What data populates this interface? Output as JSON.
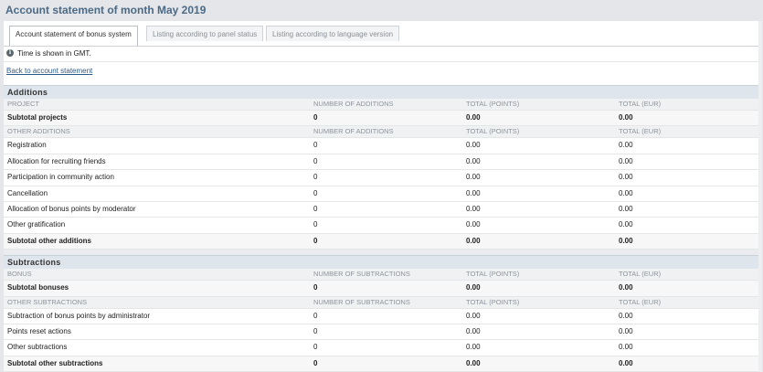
{
  "page_title": "Account statement of month May 2019",
  "tabs": [
    {
      "label": "Account statement of bonus system",
      "active": true
    },
    {
      "label": "Listing according to panel status",
      "active": false
    },
    {
      "label": "Listing according to language version",
      "active": false
    }
  ],
  "info": {
    "icon": "info-icon",
    "text": "Time is shown in GMT."
  },
  "back_link": "Back to account statement",
  "additions": {
    "title": "Additions",
    "project_header": [
      "PROJECT",
      "NUMBER OF ADDITIONS",
      "TOTAL (POINTS)",
      "TOTAL (EUR)"
    ],
    "subtotal_projects": [
      "Subtotal projects",
      "0",
      "0.00",
      "0.00"
    ],
    "other_header": [
      "OTHER ADDITIONS",
      "NUMBER OF ADDITIONS",
      "TOTAL (POINTS)",
      "TOTAL (EUR)"
    ],
    "rows": [
      [
        "Registration",
        "0",
        "0.00",
        "0.00"
      ],
      [
        "Allocation for recruiting friends",
        "0",
        "0.00",
        "0.00"
      ],
      [
        "Participation in community action",
        "0",
        "0.00",
        "0.00"
      ],
      [
        "Cancellation",
        "0",
        "0.00",
        "0.00"
      ],
      [
        "Allocation of bonus points by moderator",
        "0",
        "0.00",
        "0.00"
      ],
      [
        "Other gratification",
        "0",
        "0.00",
        "0.00"
      ]
    ],
    "subtotal_other": [
      "Subtotal other additions",
      "0",
      "0.00",
      "0.00"
    ]
  },
  "subtractions": {
    "title": "Subtractions",
    "bonus_header": [
      "BONUS",
      "NUMBER OF SUBTRACTIONS",
      "TOTAL (POINTS)",
      "TOTAL (EUR)"
    ],
    "subtotal_bonuses": [
      "Subtotal bonuses",
      "0",
      "0.00",
      "0.00"
    ],
    "other_header": [
      "OTHER SUBTRACTIONS",
      "NUMBER OF SUBTRACTIONS",
      "TOTAL (POINTS)",
      "TOTAL (EUR)"
    ],
    "rows": [
      [
        "Subtraction of bonus points by administrator",
        "0",
        "0.00",
        "0.00"
      ],
      [
        "Points reset actions",
        "0",
        "0.00",
        "0.00"
      ],
      [
        "Other subtractions",
        "0",
        "0.00",
        "0.00"
      ]
    ],
    "subtotal_other": [
      "Subtotal other subtractions",
      "0",
      "0.00",
      "0.00"
    ]
  }
}
